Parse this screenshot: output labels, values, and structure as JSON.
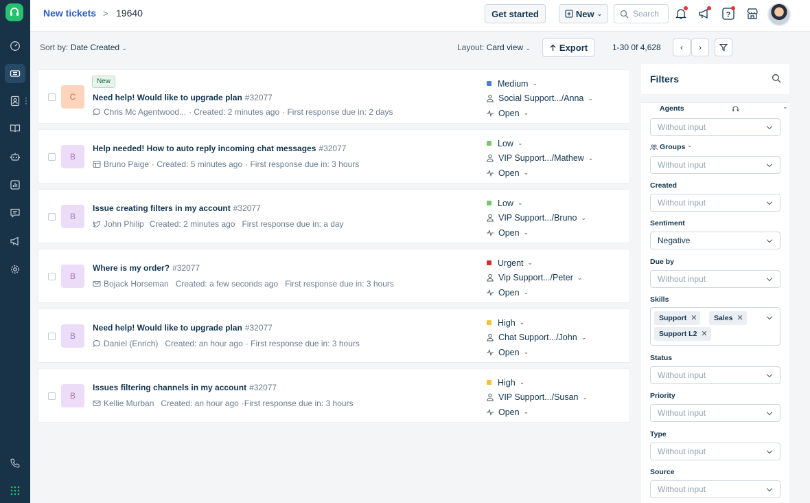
{
  "header": {
    "breadcrumb_link": "New tickets",
    "breadcrumb_sep": ">",
    "breadcrumb_current": "19640",
    "get_started_label": "Get started",
    "new_label": "New",
    "search_placeholder": "Search"
  },
  "toolbar": {
    "sort_prefix": "Sort by:",
    "sort_value": "Date Created",
    "layout_prefix": "Layout:",
    "layout_value": "Card view",
    "export_label": "Export",
    "pagination": "1-30 0f 4,628"
  },
  "tickets": [
    {
      "avatar": "C",
      "avatar_bg": "#fdd4bc",
      "avatar_fg": "#c8765a",
      "badge": "New",
      "subject": "Need help! Would like to upgrade plan",
      "ticket_id": "#32077",
      "source_icon": "chat-icon",
      "requester": "Chris Mc Agentwood...",
      "created": "· Created: 2 minutes ago",
      "due": "· First response due in: 2 days",
      "priority": "Medium",
      "priority_color": "#4c7fd1",
      "group": "Social Support.../Anna",
      "status": "Open"
    },
    {
      "avatar": "B",
      "avatar_bg": "#ecdcf7",
      "avatar_fg": "#a07cbe",
      "badge": "",
      "subject": "Help needed! How to auto reply incoming chat messages",
      "ticket_id": "#32077",
      "source_icon": "portal-icon",
      "requester": "Bruno Paige",
      "created": "· Created: 5 minutes ago",
      "due": "· First response due in: 3 hours",
      "priority": "Low",
      "priority_color": "#7ec46d",
      "group": "VIP Support.../Mathew",
      "status": "Open"
    },
    {
      "avatar": "B",
      "avatar_bg": "#ecdcf7",
      "avatar_fg": "#a07cbe",
      "badge": "",
      "subject": "Issue creating filters in my account",
      "ticket_id": "#32077",
      "source_icon": "twitter-icon",
      "requester": "John Philip",
      "created": "Created: 2 minutes ago",
      "due": "First response due in: a day",
      "priority": "Low",
      "priority_color": "#7ec46d",
      "group": "VIP Support.../Bruno",
      "status": "Open"
    },
    {
      "avatar": "B",
      "avatar_bg": "#ecdcf7",
      "avatar_fg": "#a07cbe",
      "badge": "",
      "subject": "Where is my order?",
      "ticket_id": "#32077",
      "source_icon": "email-icon",
      "requester": "Bojack Horseman",
      "created": "Created: a few seconds ago",
      "due": "First response due in: 3 hours",
      "priority": "Urgent",
      "priority_color": "#d72d30",
      "group": "Vip Support.../Peter",
      "status": "Open"
    },
    {
      "avatar": "B",
      "avatar_bg": "#ecdcf7",
      "avatar_fg": "#a07cbe",
      "badge": "",
      "subject": "Need help! Would like to upgrade plan",
      "ticket_id": "#32077",
      "source_icon": "chat-icon",
      "requester": "Daniel (Enrich)",
      "created": "Created: an hour ago",
      "due": "· First response due in: 3 hours",
      "priority": "High",
      "priority_color": "#f3c23c",
      "group": "Chat Support.../John",
      "status": "Open"
    },
    {
      "avatar": "B",
      "avatar_bg": "#ecdcf7",
      "avatar_fg": "#a07cbe",
      "badge": "",
      "subject": "Issues filtering channels in my account",
      "ticket_id": "#32077",
      "source_icon": "email-icon",
      "requester": "Kellie Murban",
      "created": "Created: an hour ago",
      "due": "·First response due in: 3 hours",
      "priority": "High",
      "priority_color": "#f3c23c",
      "group": "VIP Support.../Susan",
      "status": "Open"
    }
  ],
  "filters": {
    "title": "Filters",
    "agents_label": "Agents",
    "agents_value": "Without input",
    "groups_label": "Groups",
    "groups_value": "Without input",
    "created_label": "Created",
    "created_value": "Without input",
    "sentiment_label": "Sentiment",
    "sentiment_value": "Negative",
    "dueby_label": "Due by",
    "dueby_value": "Without input",
    "skills_label": "Skills",
    "skills": [
      "Support",
      "Sales",
      "Support L2"
    ],
    "status_label": "Status",
    "status_value": "Without input",
    "priority_label": "Priority",
    "priority_value": "Without input",
    "type_label": "Type",
    "type_value": "Without input",
    "source_label": "Source",
    "source_value": "Without input"
  }
}
